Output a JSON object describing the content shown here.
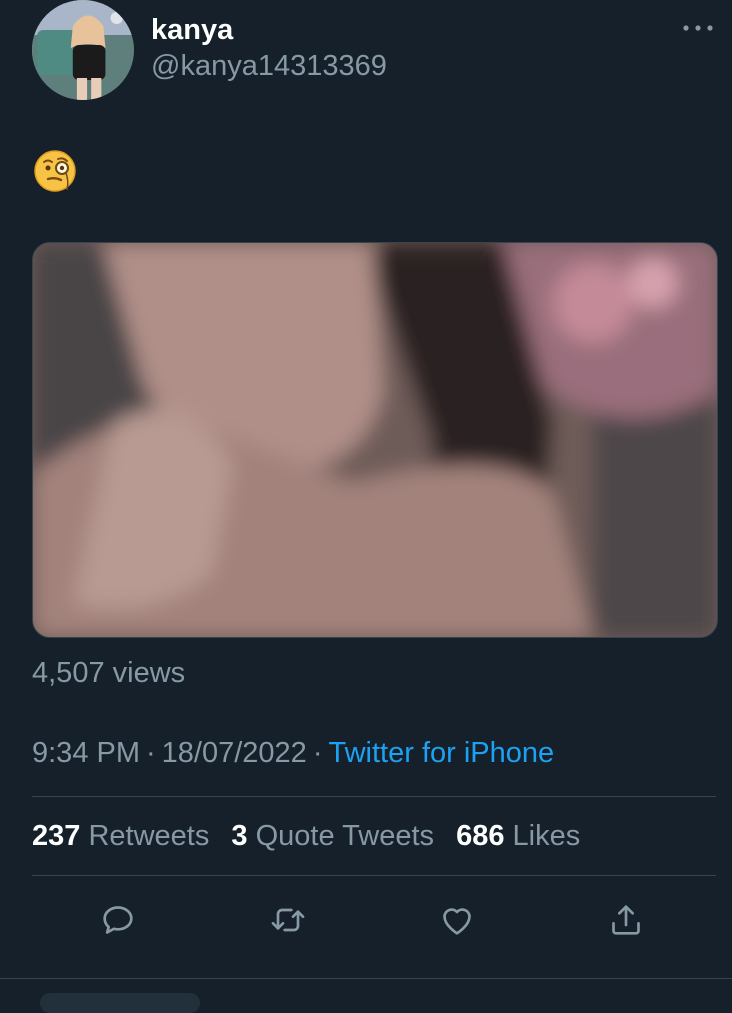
{
  "tweet": {
    "display_name": "kanya",
    "handle": "@kanya14313369",
    "text_emoji": "🧐",
    "views": "4,507 views",
    "time": "9:34 PM",
    "date": "18/07/2022",
    "separator": "·",
    "source": "Twitter for iPhone"
  },
  "stats": {
    "retweets_count": "237",
    "retweets_label": "Retweets",
    "quotes_count": "3",
    "quotes_label": "Quote Tweets",
    "likes_count": "686",
    "likes_label": "Likes"
  },
  "icons": {
    "more": "more-horizontal-icon",
    "reply": "reply-icon",
    "retweet": "retweet-icon",
    "like": "heart-icon",
    "share": "share-icon"
  },
  "colors": {
    "background": "#15202b",
    "secondary_text": "#8899a6",
    "link": "#1da1f2",
    "divider": "#38444d"
  }
}
